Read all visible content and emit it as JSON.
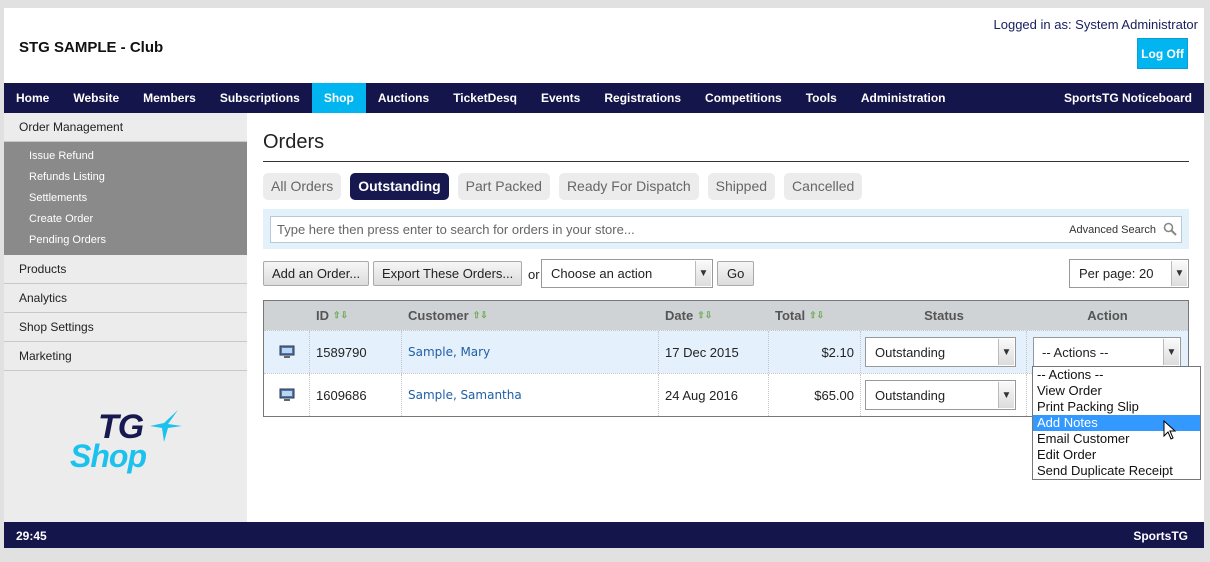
{
  "header": {
    "club_title": "STG SAMPLE - Club",
    "logged_in": "Logged in as: System Administrator",
    "logoff_label": "Log Off"
  },
  "topnav": {
    "items": [
      "Home",
      "Website",
      "Members",
      "Subscriptions",
      "Shop",
      "Auctions",
      "TicketDesq",
      "Events",
      "Registrations",
      "Competitions",
      "Tools",
      "Administration"
    ],
    "active": "Shop",
    "right_item": "SportsTG Noticeboard"
  },
  "sidebar": {
    "order_management": "Order Management",
    "sub_items": [
      "Issue Refund",
      "Refunds Listing",
      "Settlements",
      "Create Order",
      "Pending Orders"
    ],
    "items": [
      "Products",
      "Analytics",
      "Shop Settings",
      "Marketing"
    ],
    "logo_top": "TG",
    "logo_bottom": "Shop"
  },
  "main": {
    "title": "Orders",
    "tabs": [
      "All Orders",
      "Outstanding",
      "Part Packed",
      "Ready For Dispatch",
      "Shipped",
      "Cancelled"
    ],
    "active_tab": "Outstanding",
    "search_placeholder": "Type here then press enter to search for orders in your store...",
    "advanced_search": "Advanced Search",
    "add_order": "Add an Order...",
    "export_orders": "Export These Orders...",
    "or_text": "or",
    "choose_action": "Choose an action",
    "go": "Go",
    "per_page": "Per page: 20"
  },
  "table": {
    "headers": [
      "ID",
      "Customer",
      "Date",
      "Total",
      "Status",
      "Action"
    ],
    "rows": [
      {
        "id": "1589790",
        "first": "Sample,",
        "last": "Mary",
        "date": "17 Dec 2015",
        "total": "$2.10",
        "status": "Outstanding",
        "action": "-- Actions --"
      },
      {
        "id": "1609686",
        "first": "Sample,",
        "last": "Samantha",
        "date": "24 Aug 2016",
        "total": "$65.00",
        "status": "Outstanding"
      }
    ]
  },
  "action_dropdown": {
    "options": [
      "-- Actions --",
      "View Order",
      "Print Packing Slip",
      "Add Notes",
      "Email Customer",
      "Edit Order",
      "Send Duplicate Receipt"
    ],
    "highlighted": "Add Notes"
  },
  "footer": {
    "time": "29:45",
    "brand": "SportsTG"
  },
  "colors": {
    "nav_bg": "#14154b",
    "accent": "#00b5f0",
    "link": "#1f5fa6"
  }
}
